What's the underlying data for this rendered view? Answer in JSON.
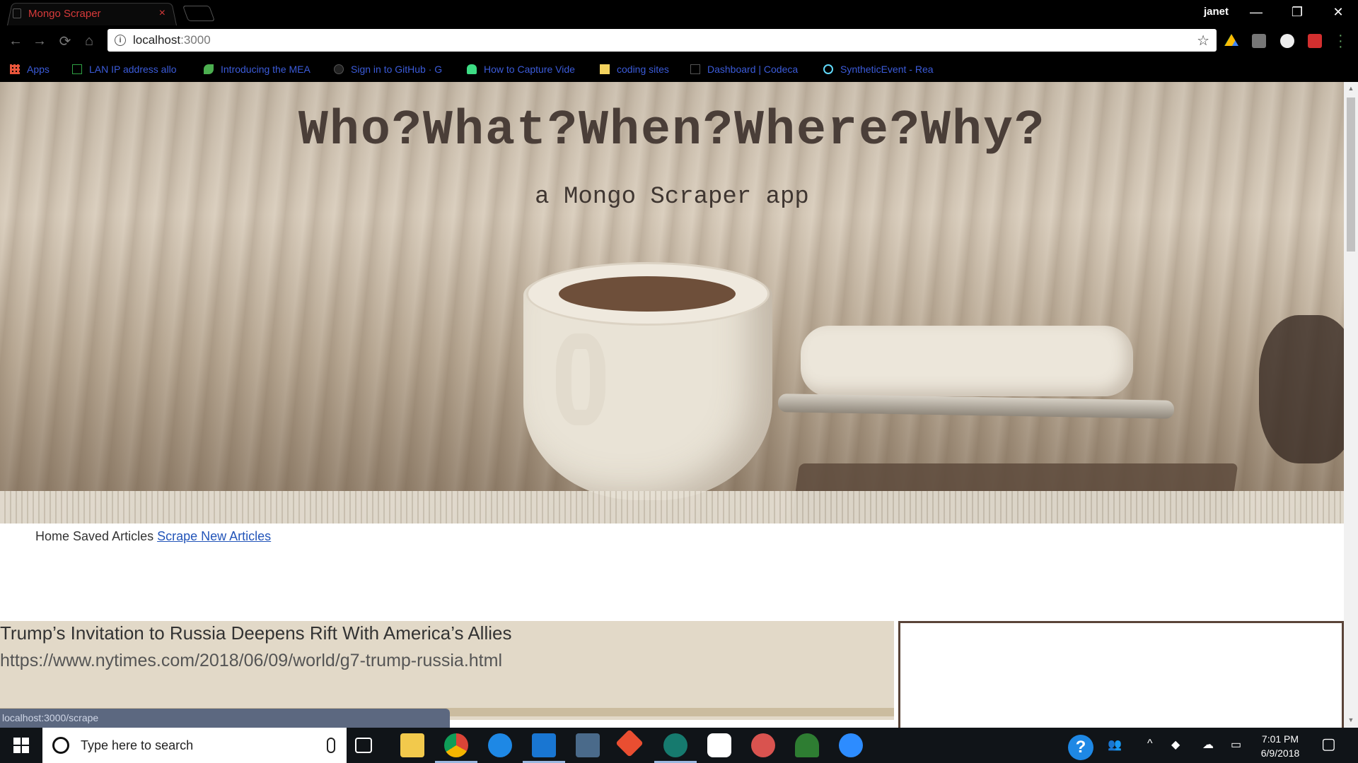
{
  "browser": {
    "tab_title": "Mongo Scraper",
    "tab_close": "×",
    "profile_name": "janet",
    "window_controls": {
      "minimize": "—",
      "restore": "❐",
      "close": "✕"
    },
    "url_host": "localhost",
    "url_port": ":3000",
    "nav": {
      "back": "←",
      "forward": "→",
      "reload": "⟳",
      "home": "⌂"
    },
    "star_icon": "☆",
    "bookmarks": [
      {
        "label": "Apps",
        "icon": "apps-grid-icon",
        "color": "#e8553b"
      },
      {
        "label": "LAN IP address allo",
        "icon": "page-icon",
        "color": "#2ea043"
      },
      {
        "label": "Introducing the MEA",
        "icon": "leaf-icon",
        "color": "#4caf50"
      },
      {
        "label": "Sign in to GitHub · G",
        "icon": "github-icon",
        "color": "#222"
      },
      {
        "label": "How to Capture Vide",
        "icon": "android-icon",
        "color": "#3ddc84"
      },
      {
        "label": "coding sites",
        "icon": "folder-icon",
        "color": "#f4d35e"
      },
      {
        "label": "Dashboard | Codeca",
        "icon": "codecademy-icon",
        "color": "#444"
      },
      {
        "label": "SyntheticEvent - Rea",
        "icon": "react-icon",
        "color": "#61dafb"
      }
    ]
  },
  "page": {
    "hero_title": "Who?What?When?Where?Why?",
    "hero_subtitle": "a Mongo Scraper app",
    "nav_home": "Home",
    "nav_saved": "Saved Articles",
    "nav_scrape": "Scrape New Articles",
    "article": {
      "title": "Trump’s Invitation to Russia Deepens Rift With America’s Allies",
      "link": "https://www.nytimes.com/2018/06/09/world/g7-trump-russia.html"
    },
    "status_url": "localhost:3000/scrape"
  },
  "taskbar": {
    "search_placeholder": "Type here to search",
    "time": "7:01 PM",
    "date": "6/9/2018",
    "apps": [
      {
        "name": "task-view-icon",
        "color": "#101418"
      },
      {
        "name": "file-explorer-icon",
        "color": "#f2c94c"
      },
      {
        "name": "chrome-icon",
        "color": "#db4437"
      },
      {
        "name": "firefox-icon",
        "color": "#1e88e5"
      },
      {
        "name": "vscode-icon",
        "color": "#1976d2"
      },
      {
        "name": "mysql-workbench-icon",
        "color": "#4a6a8a"
      },
      {
        "name": "git-icon",
        "color": "#e94e31"
      },
      {
        "name": "gitkraken-icon",
        "color": "#167a6e"
      },
      {
        "name": "slack-icon",
        "color": "#ffffff"
      },
      {
        "name": "paint-icon",
        "color": "#d9534f"
      },
      {
        "name": "robo3t-icon",
        "color": "#2e7d32"
      },
      {
        "name": "zoom-icon",
        "color": "#2d8cff"
      }
    ],
    "tray_help": "?",
    "tray_people": "👥",
    "tray_chevron": "^"
  }
}
